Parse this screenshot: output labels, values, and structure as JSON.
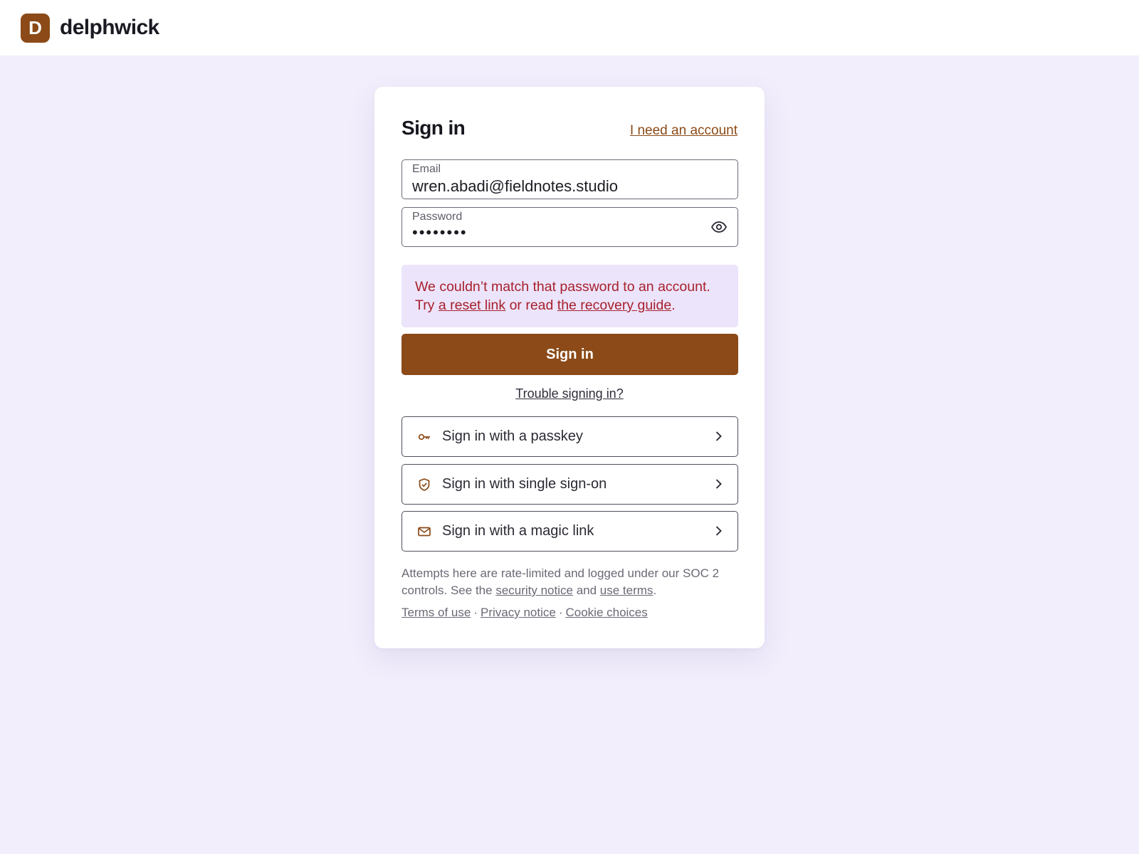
{
  "brand": {
    "initial": "D",
    "name": "delphwick"
  },
  "card": {
    "title": "Sign in",
    "need_account": "I need an account"
  },
  "email": {
    "label": "Email",
    "value": "wren.abadi@fieldnotes.studio"
  },
  "password": {
    "label": "Password",
    "masked": "••••••••",
    "toggle_icon": "eye-icon"
  },
  "error": {
    "line1": "We couldn’t match that password to an account.",
    "try": "Try ",
    "reset_link": "a reset link",
    "or_read": " or read ",
    "guide_link": "the recovery guide",
    "period": "."
  },
  "submit_label": "Sign in",
  "trouble_label": "Trouble signing in?",
  "alternatives": [
    {
      "label": "Sign in with a passkey",
      "icon": "key-icon"
    },
    {
      "label": "Sign in with single sign-on",
      "icon": "shield-check-icon"
    },
    {
      "label": "Sign in with a magic link",
      "icon": "mail-icon"
    }
  ],
  "fineprint": {
    "text1": "Attempts here are rate-limited and logged under our SOC 2 controls. See the ",
    "security_link": "security notice",
    "and": " and ",
    "terms_link": "use terms",
    "period": "."
  },
  "footer": {
    "terms": "Terms of use",
    "privacy": "Privacy notice",
    "cookies": "Cookie choices",
    "separator": "·"
  },
  "colors": {
    "brand": "#8b4a17",
    "background": "#f2eefc",
    "error_bg": "#ece4fb",
    "error_text": "#a8202c"
  }
}
